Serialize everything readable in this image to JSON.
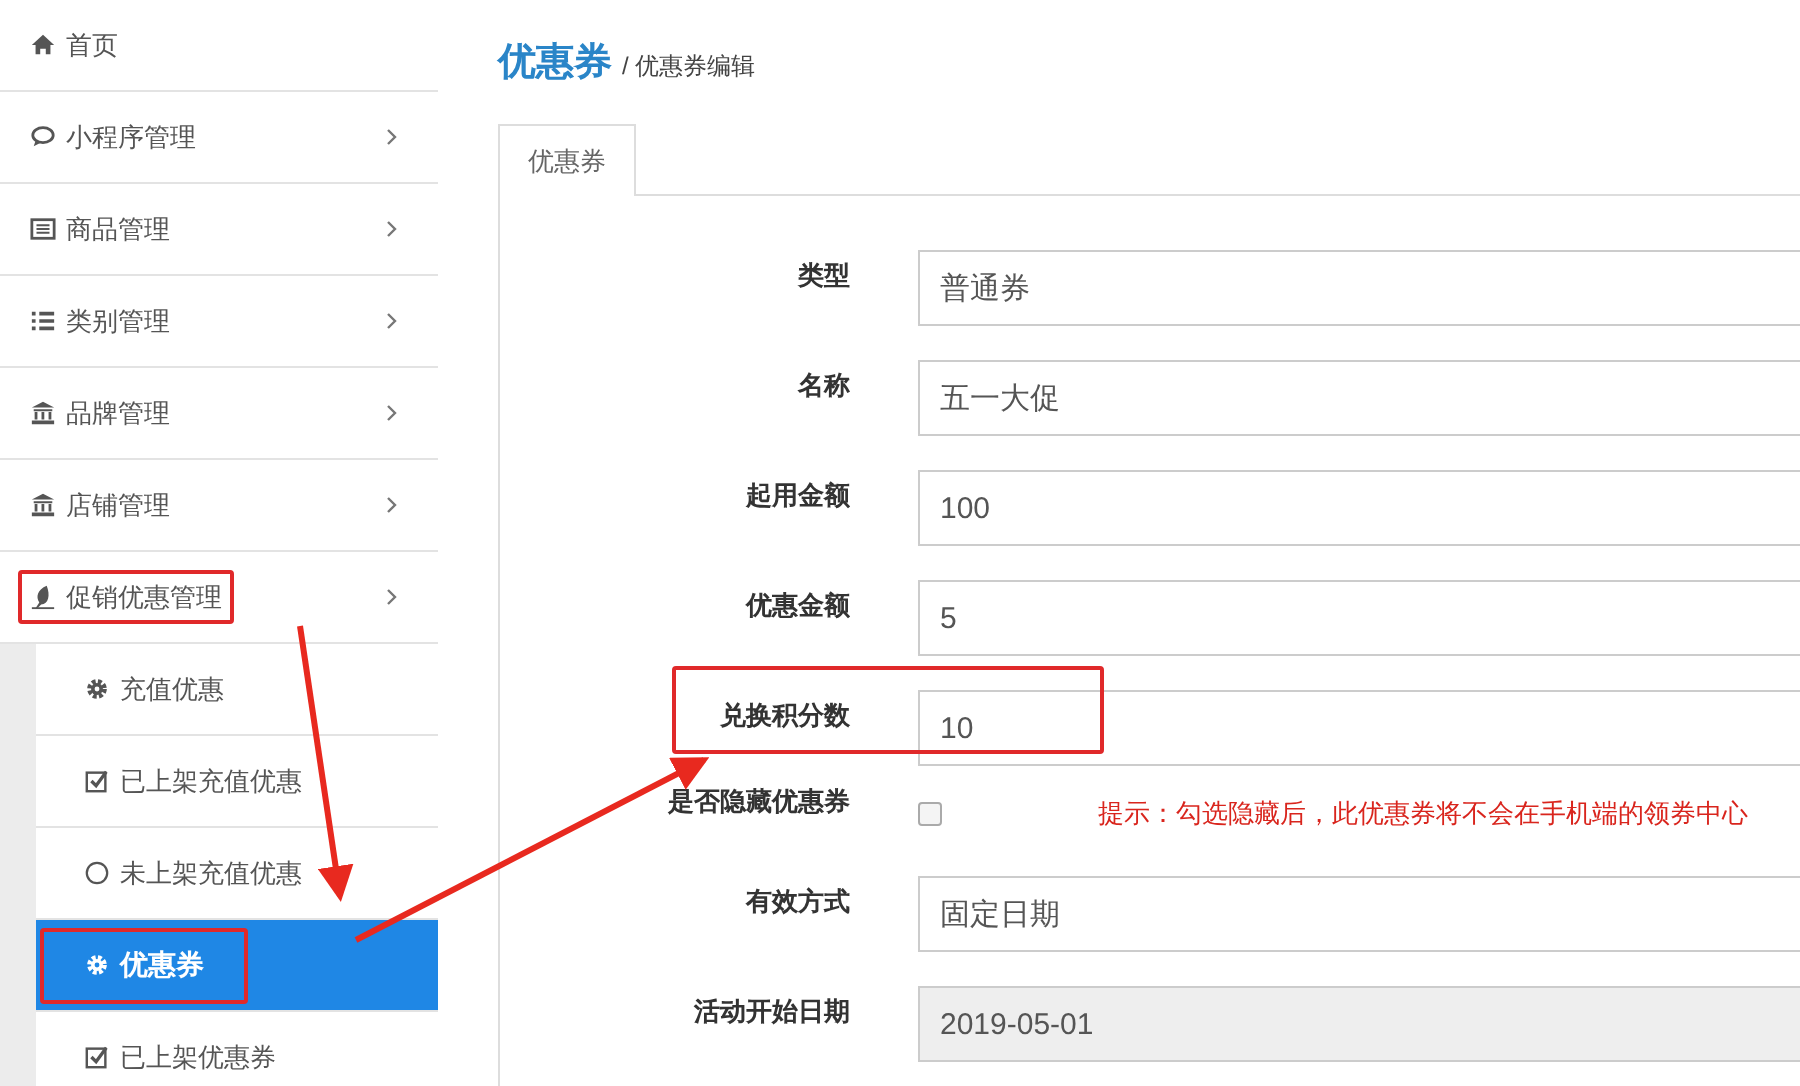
{
  "sidebar": {
    "items": [
      {
        "label": "首页",
        "selected": false,
        "highlighted": false
      },
      {
        "label": "小程序管理",
        "selected": false,
        "highlighted": false,
        "submenu": true
      },
      {
        "label": "商品管理",
        "selected": false,
        "highlighted": false,
        "submenu": true
      },
      {
        "label": "类别管理",
        "selected": false,
        "highlighted": false,
        "submenu": true
      },
      {
        "label": "品牌管理",
        "selected": false,
        "highlighted": false,
        "submenu": true
      },
      {
        "label": "店铺管理",
        "selected": false,
        "highlighted": false,
        "submenu": true
      },
      {
        "label": "促销优惠管理",
        "selected": false,
        "highlighted": true,
        "submenu": true,
        "expanded": true,
        "children": [
          {
            "label": "充值优惠",
            "selected": false,
            "highlighted": false
          },
          {
            "label": "已上架充值优惠",
            "selected": false,
            "highlighted": false
          },
          {
            "label": "未上架充值优惠",
            "selected": false,
            "highlighted": false
          },
          {
            "label": "优惠券",
            "selected": true,
            "highlighted": true
          },
          {
            "label": "已上架优惠券",
            "selected": false,
            "highlighted": false
          }
        ]
      }
    ]
  },
  "header": {
    "title": "优惠券",
    "breadcrumb": "/ 优惠券编辑"
  },
  "tabs": [
    {
      "label": "优惠券",
      "selected": true
    }
  ],
  "form": {
    "rows": [
      {
        "kind": "input",
        "label": "类型",
        "value": "普通券",
        "disabled": false,
        "highlighted": false
      },
      {
        "kind": "input",
        "label": "名称",
        "value": "五一大促",
        "disabled": false,
        "highlighted": false
      },
      {
        "kind": "input",
        "label": "起用金额",
        "value": "100",
        "disabled": false,
        "highlighted": false
      },
      {
        "kind": "input",
        "label": "优惠金额",
        "value": "5",
        "disabled": false,
        "highlighted": false
      },
      {
        "kind": "input",
        "label": "兑换积分数",
        "value": "10",
        "disabled": false,
        "highlighted": true
      },
      {
        "kind": "checkbox",
        "label": "是否隐藏优惠券",
        "checked": false,
        "hint": "提示：勾选隐藏后，此优惠券将不会在手机端的领券中心",
        "highlighted": false
      },
      {
        "kind": "input",
        "label": "有效方式",
        "value": "固定日期",
        "disabled": false,
        "highlighted": false
      },
      {
        "kind": "input",
        "label": "活动开始日期",
        "value": "2019-05-01",
        "disabled": true,
        "highlighted": false
      }
    ]
  }
}
